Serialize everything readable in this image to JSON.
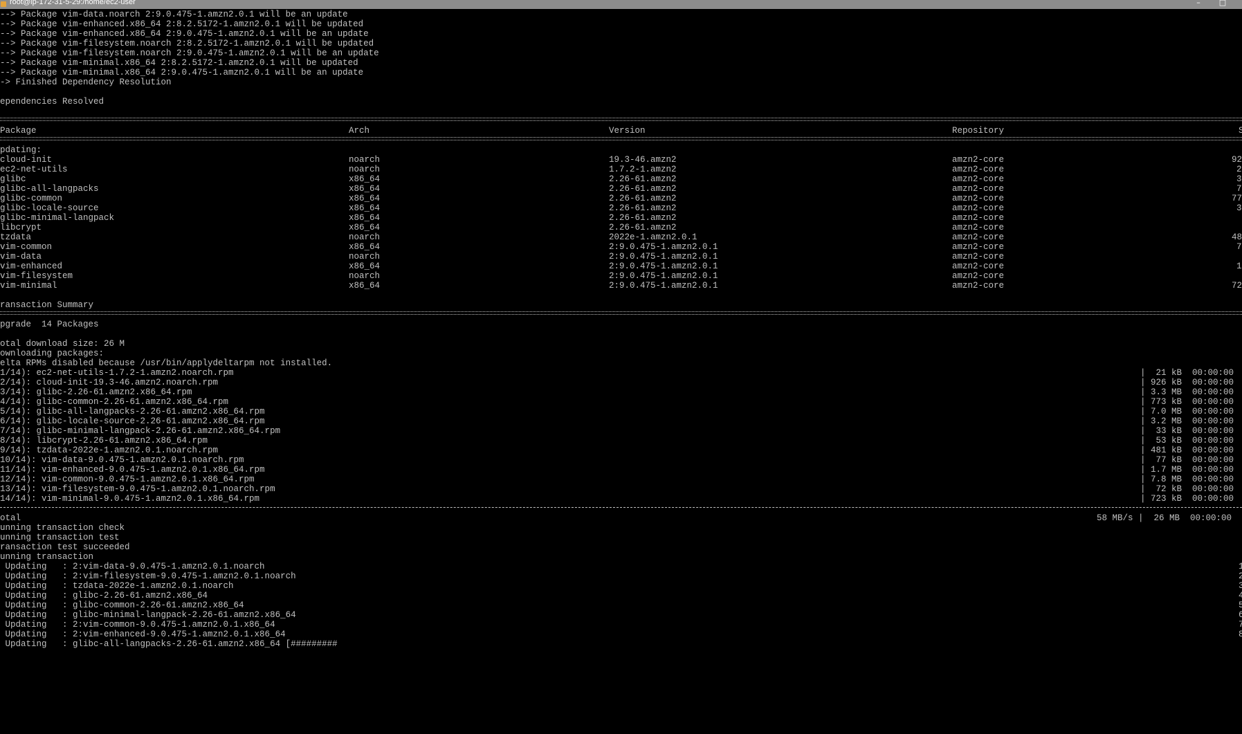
{
  "window": {
    "title": "root@ip-172-31-5-29:/home/ec2-user",
    "minimize_glyph": "–",
    "close_glyph": "□"
  },
  "terminal": {
    "update_lines": [
      "--> Package vim-data.noarch 2:9.0.475-1.amzn2.0.1 will be an update",
      "--> Package vim-enhanced.x86_64 2:8.2.5172-1.amzn2.0.1 will be updated",
      "--> Package vim-enhanced.x86_64 2:9.0.475-1.amzn2.0.1 will be an update",
      "--> Package vim-filesystem.noarch 2:8.2.5172-1.amzn2.0.1 will be updated",
      "--> Package vim-filesystem.noarch 2:9.0.475-1.amzn2.0.1 will be an update",
      "--> Package vim-minimal.x86_64 2:8.2.5172-1.amzn2.0.1 will be updated",
      "--> Package vim-minimal.x86_64 2:9.0.475-1.amzn2.0.1 will be an update",
      "-> Finished Dependency Resolution"
    ],
    "deps_resolved": "ependencies Resolved",
    "headers": {
      "package": "Package",
      "arch": "Arch",
      "version": "Version",
      "repository": "Repository",
      "size": "S"
    },
    "updating_label": "pdating:",
    "packages": [
      {
        "name": "cloud-init",
        "arch": "noarch",
        "version": "19.3-46.amzn2",
        "repo": "amzn2-core",
        "size": "92"
      },
      {
        "name": "ec2-net-utils",
        "arch": "noarch",
        "version": "1.7.2-1.amzn2",
        "repo": "amzn2-core",
        "size": "2"
      },
      {
        "name": "glibc",
        "arch": "x86_64",
        "version": "2.26-61.amzn2",
        "repo": "amzn2-core",
        "size": "3"
      },
      {
        "name": "glibc-all-langpacks",
        "arch": "x86_64",
        "version": "2.26-61.amzn2",
        "repo": "amzn2-core",
        "size": "7"
      },
      {
        "name": "glibc-common",
        "arch": "x86_64",
        "version": "2.26-61.amzn2",
        "repo": "amzn2-core",
        "size": "77"
      },
      {
        "name": "glibc-locale-source",
        "arch": "x86_64",
        "version": "2.26-61.amzn2",
        "repo": "amzn2-core",
        "size": "3"
      },
      {
        "name": "glibc-minimal-langpack",
        "arch": "x86_64",
        "version": "2.26-61.amzn2",
        "repo": "amzn2-core",
        "size": ""
      },
      {
        "name": "libcrypt",
        "arch": "x86_64",
        "version": "2.26-61.amzn2",
        "repo": "amzn2-core",
        "size": ""
      },
      {
        "name": "tzdata",
        "arch": "noarch",
        "version": "2022e-1.amzn2.0.1",
        "repo": "amzn2-core",
        "size": "48"
      },
      {
        "name": "vim-common",
        "arch": "x86_64",
        "version": "2:9.0.475-1.amzn2.0.1",
        "repo": "amzn2-core",
        "size": "7"
      },
      {
        "name": "vim-data",
        "arch": "noarch",
        "version": "2:9.0.475-1.amzn2.0.1",
        "repo": "amzn2-core",
        "size": ""
      },
      {
        "name": "vim-enhanced",
        "arch": "x86_64",
        "version": "2:9.0.475-1.amzn2.0.1",
        "repo": "amzn2-core",
        "size": "1"
      },
      {
        "name": "vim-filesystem",
        "arch": "noarch",
        "version": "2:9.0.475-1.amzn2.0.1",
        "repo": "amzn2-core",
        "size": ""
      },
      {
        "name": "vim-minimal",
        "arch": "x86_64",
        "version": "2:9.0.475-1.amzn2.0.1",
        "repo": "amzn2-core",
        "size": "72"
      }
    ],
    "transaction_summary": "ransaction Summary",
    "upgrade_count": "pgrade  14 Packages",
    "download_size": "otal download size: 26 M",
    "downloading": "ownloading packages:",
    "delta_note": "elta RPMs disabled because /usr/bin/applydeltarpm not installed.",
    "downloads": [
      {
        "file": "1/14): ec2-net-utils-1.7.2-1.amzn2.noarch.rpm",
        "stats": "|  21 kB  00:00:00"
      },
      {
        "file": "2/14): cloud-init-19.3-46.amzn2.noarch.rpm",
        "stats": "| 926 kB  00:00:00"
      },
      {
        "file": "3/14): glibc-2.26-61.amzn2.x86_64.rpm",
        "stats": "| 3.3 MB  00:00:00"
      },
      {
        "file": "4/14): glibc-common-2.26-61.amzn2.x86_64.rpm",
        "stats": "| 773 kB  00:00:00"
      },
      {
        "file": "5/14): glibc-all-langpacks-2.26-61.amzn2.x86_64.rpm",
        "stats": "| 7.0 MB  00:00:00"
      },
      {
        "file": "6/14): glibc-locale-source-2.26-61.amzn2.x86_64.rpm",
        "stats": "| 3.2 MB  00:00:00"
      },
      {
        "file": "7/14): glibc-minimal-langpack-2.26-61.amzn2.x86_64.rpm",
        "stats": "|  33 kB  00:00:00"
      },
      {
        "file": "8/14): libcrypt-2.26-61.amzn2.x86_64.rpm",
        "stats": "|  53 kB  00:00:00"
      },
      {
        "file": "9/14): tzdata-2022e-1.amzn2.0.1.noarch.rpm",
        "stats": "| 481 kB  00:00:00"
      },
      {
        "file": "10/14): vim-data-9.0.475-1.amzn2.0.1.noarch.rpm",
        "stats": "|  77 kB  00:00:00"
      },
      {
        "file": "11/14): vim-enhanced-9.0.475-1.amzn2.0.1.x86_64.rpm",
        "stats": "| 1.7 MB  00:00:00"
      },
      {
        "file": "12/14): vim-common-9.0.475-1.amzn2.0.1.x86_64.rpm",
        "stats": "| 7.8 MB  00:00:00"
      },
      {
        "file": "13/14): vim-filesystem-9.0.475-1.amzn2.0.1.noarch.rpm",
        "stats": "|  72 kB  00:00:00"
      },
      {
        "file": "14/14): vim-minimal-9.0.475-1.amzn2.0.1.x86_64.rpm",
        "stats": "| 723 kB  00:00:00"
      }
    ],
    "total_label": "otal",
    "total_stats": "58 MB/s |  26 MB  00:00:00",
    "run_lines": [
      "unning transaction check",
      "unning transaction test",
      "ransaction test succeeded",
      "unning transaction"
    ],
    "updating_steps": [
      " Updating   : 2:vim-data-9.0.475-1.amzn2.0.1.noarch",
      " Updating   : 2:vim-filesystem-9.0.475-1.amzn2.0.1.noarch",
      " Updating   : tzdata-2022e-1.amzn2.0.1.noarch",
      " Updating   : glibc-2.26-61.amzn2.x86_64",
      " Updating   : glibc-common-2.26-61.amzn2.x86_64",
      " Updating   : glibc-minimal-langpack-2.26-61.amzn2.x86_64",
      " Updating   : 2:vim-common-9.0.475-1.amzn2.0.1.x86_64",
      " Updating   : 2:vim-enhanced-9.0.475-1.amzn2.0.1.x86_64",
      " Updating   : glibc-all-langpacks-2.26-61.amzn2.x86_64 [#########"
    ],
    "step_counters": [
      "1",
      "2",
      "3",
      "4",
      "5",
      "6",
      "7",
      "8",
      ""
    ]
  },
  "colors": {
    "background": "#000000",
    "foreground": "#c0c0c0",
    "titlebar": "#8c8c8c",
    "title_text": "#ffffff"
  }
}
